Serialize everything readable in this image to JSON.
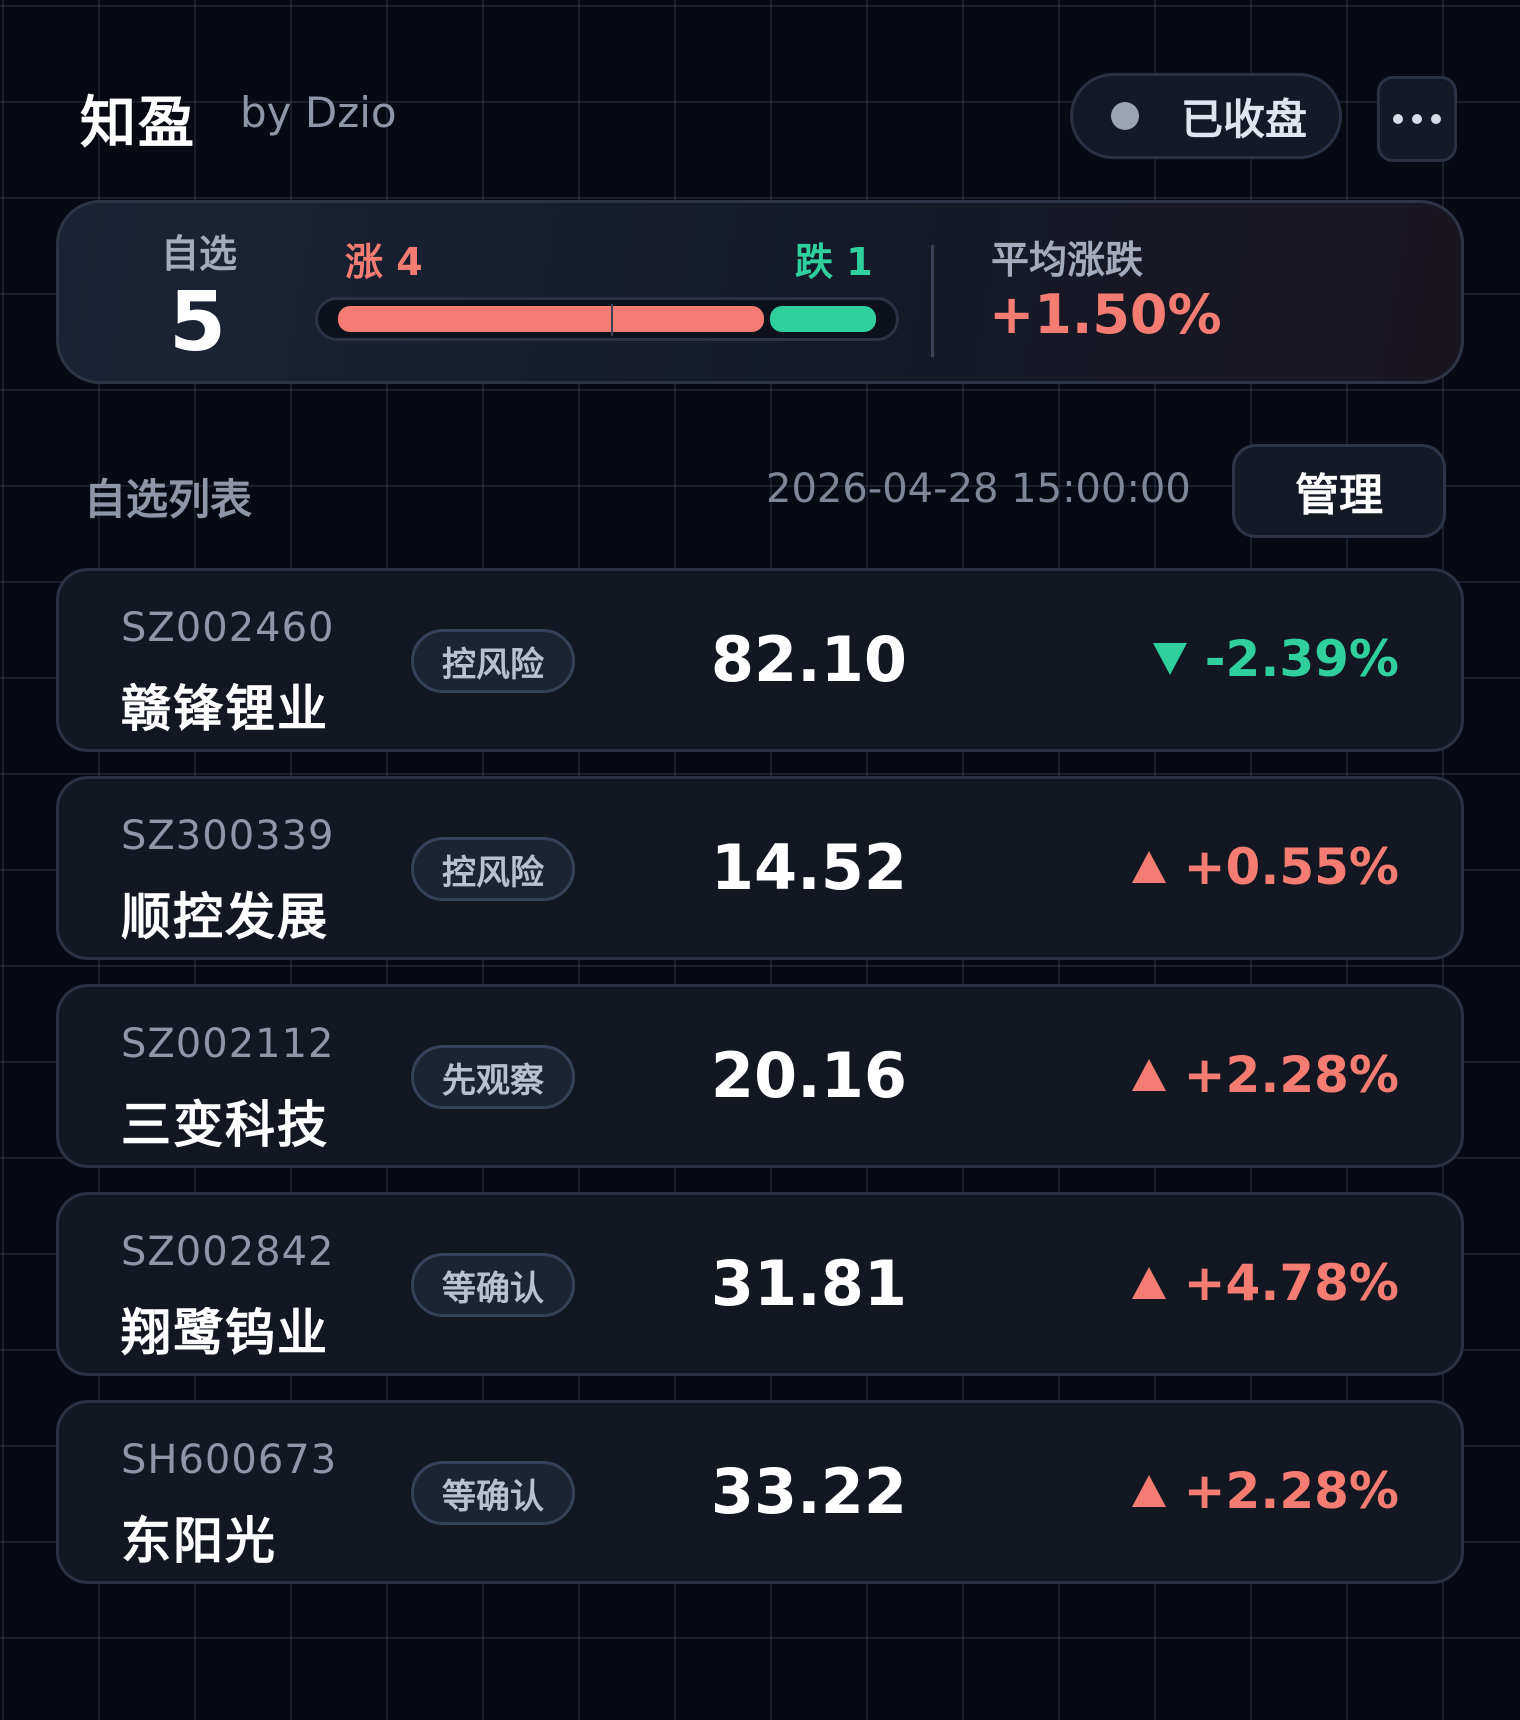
{
  "header": {
    "app_title": "知盈",
    "byline": "by Dzio",
    "market_status": "已收盘",
    "more_icon": "more-dots-icon"
  },
  "summary": {
    "watchlist_label": "自选",
    "watchlist_count": "5",
    "up_label": "涨 4",
    "down_label": "跌 1",
    "up_count": 4,
    "down_count": 1,
    "avg_change_label": "平均涨跌",
    "avg_change_value": "+1.50%"
  },
  "list": {
    "title": "自选列表",
    "timestamp": "2026-04-28 15:00:00",
    "manage_label": "管理"
  },
  "stocks": [
    {
      "code": "SZ002460",
      "name": "赣锋锂业",
      "tag": "控风险",
      "price": "82.10",
      "change": "-2.39%",
      "direction": "down"
    },
    {
      "code": "SZ300339",
      "name": "顺控发展",
      "tag": "控风险",
      "price": "14.52",
      "change": "+0.55%",
      "direction": "up"
    },
    {
      "code": "SZ002112",
      "name": "三变科技",
      "tag": "先观察",
      "price": "20.16",
      "change": "+2.28%",
      "direction": "up"
    },
    {
      "code": "SZ002842",
      "name": "翔鹭钨业",
      "tag": "等确认",
      "price": "31.81",
      "change": "+4.78%",
      "direction": "up"
    },
    {
      "code": "SH600673",
      "name": "东阳光",
      "tag": "等确认",
      "price": "33.22",
      "change": "+2.28%",
      "direction": "up"
    }
  ],
  "colors": {
    "up": "#f47c72",
    "down": "#2fd09c",
    "background": "#070a12"
  }
}
